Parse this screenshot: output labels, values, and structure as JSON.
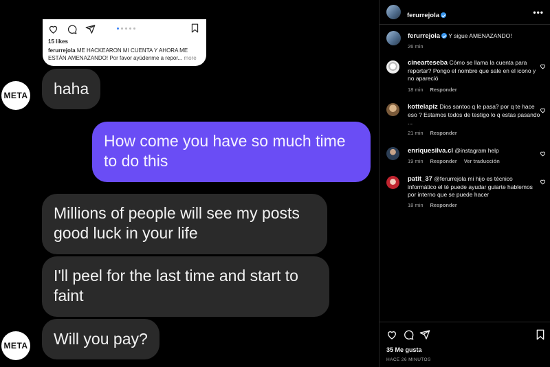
{
  "chat": {
    "avatar_text": "META",
    "shared_post": {
      "likes": "15 likes",
      "username": "ferurrejola",
      "caption": "ME HACKEARON MI CUENTA Y AHORA ME ESTÁN AMENAZANDO! Por favor ayúdenme a repor...",
      "more": "more"
    },
    "messages": [
      {
        "text": "haha"
      },
      {
        "text": "How come you have so much time to do this"
      },
      {
        "text": "Millions of people will see my posts good luck in your life"
      },
      {
        "text": "I'll peel for the last time and start to faint"
      },
      {
        "text": "Will you pay?"
      }
    ]
  },
  "panel": {
    "owner": "ferurrejola",
    "caption": "Y sigue AMENAZANDO!",
    "caption_time": "26 min",
    "comments": [
      {
        "user": "cineartesebа",
        "text": "Cómo se llama la cuenta para reportar? Pongo el nombre que sale en el icono y no apareció",
        "time": "18 min",
        "reply": "Responder"
      },
      {
        "user": "kottelapiz",
        "text": "Dios santoo q le pasa? por q te hace eso ? Estamos todos de testigo lo q estas pasando ...",
        "time": "21 min",
        "reply": "Responder"
      },
      {
        "user": "enriquesilva.cl",
        "text": "@instagram help",
        "time": "19 min",
        "reply": "Responder",
        "translate": "Ver traducción"
      },
      {
        "user": "patit_37",
        "text": "@ferurrejola mi hijo es técnico informático el té puede ayudar guiarte hablemos por interno que se puede hacer",
        "time": "18 min",
        "reply": "Responder"
      }
    ],
    "likes": "35 Me gusta",
    "time_ago": "HACE 26 MINUTOS"
  }
}
